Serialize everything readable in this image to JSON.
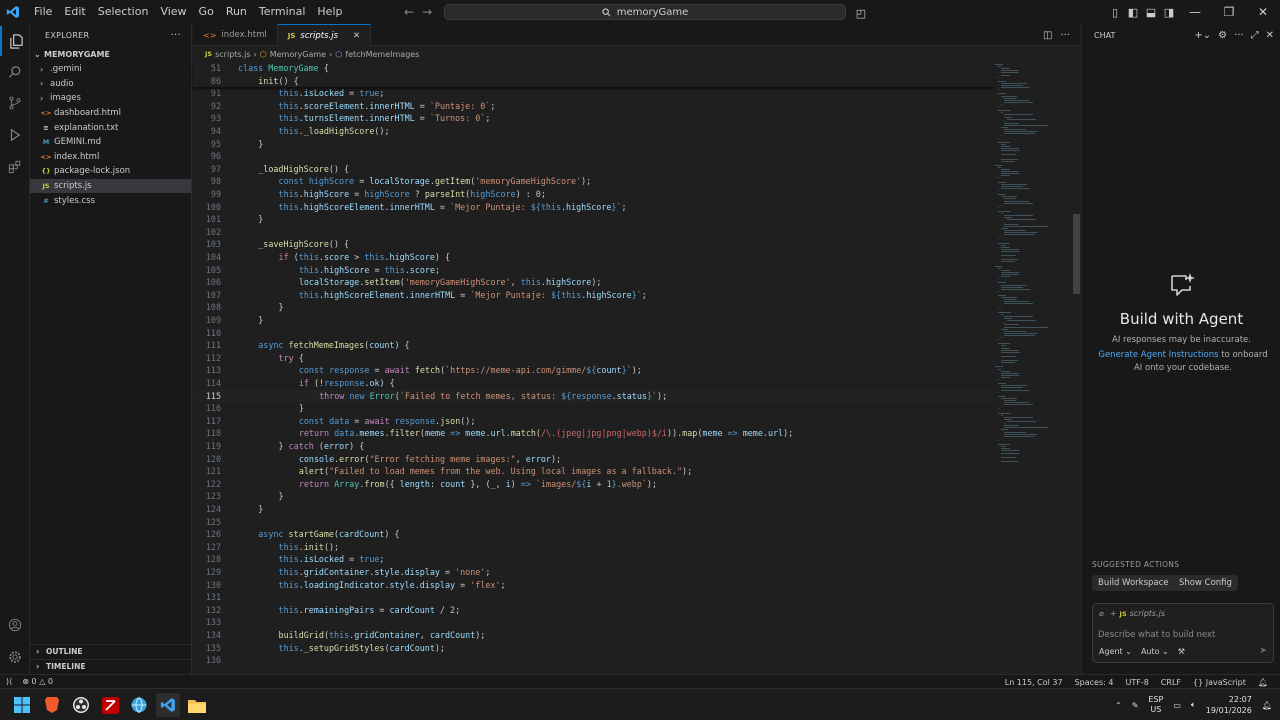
{
  "app": {
    "menu": [
      "File",
      "Edit",
      "Selection",
      "View",
      "Go",
      "Run",
      "Terminal",
      "Help"
    ],
    "search_text": "memoryGame"
  },
  "explorer": {
    "header": "EXPLORER",
    "root": "MEMORYGAME",
    "items": [
      {
        "label": ".gemini",
        "type": "folder"
      },
      {
        "label": "audio",
        "type": "folder"
      },
      {
        "label": "images",
        "type": "folder"
      },
      {
        "label": "dashboard.html",
        "type": "html"
      },
      {
        "label": "explanation.txt",
        "type": "txt"
      },
      {
        "label": "GEMINI.md",
        "type": "md"
      },
      {
        "label": "index.html",
        "type": "html"
      },
      {
        "label": "package-lock.json",
        "type": "json"
      },
      {
        "label": "scripts.js",
        "type": "js",
        "selected": true
      },
      {
        "label": "styles.css",
        "type": "css"
      }
    ],
    "outline": "OUTLINE",
    "timeline": "TIMELINE"
  },
  "tabs": [
    {
      "label": "index.html",
      "active": false
    },
    {
      "label": "scripts.js",
      "active": true
    }
  ],
  "breadcrumb": [
    "scripts.js",
    "MemoryGame",
    "fetchMemeImages"
  ],
  "code": {
    "current_line": 115,
    "lines": [
      {
        "n": "51",
        "indent": 0,
        "html": "<span class=\"kw\">class</span> <span class=\"cls\">MemoryGame</span> {"
      },
      {
        "n": "86",
        "indent": 1,
        "html": "<span class=\"fn\">init</span>() {"
      },
      {
        "n": "91",
        "indent": 2,
        "html": "<span class=\"kw\">this</span>.<span class=\"pr\">isLocked</span> = <span class=\"kw\">true</span>;"
      },
      {
        "n": "92",
        "indent": 2,
        "html": "<span class=\"kw\">this</span>.<span class=\"pr\">scoreElement</span>.<span class=\"pr\">innerHTML</span> = <span class=\"str\">`Puntaje: 0`</span>;"
      },
      {
        "n": "93",
        "indent": 2,
        "html": "<span class=\"kw\">this</span>.<span class=\"pr\">turnsElement</span>.<span class=\"pr\">innerHTML</span> = <span class=\"str\">`Turnos: 0`</span>;"
      },
      {
        "n": "94",
        "indent": 2,
        "html": "<span class=\"kw\">this</span>.<span class=\"fn\">_loadHighScore</span>();"
      },
      {
        "n": "95",
        "indent": 1,
        "html": "}"
      },
      {
        "n": "96",
        "indent": 0,
        "html": ""
      },
      {
        "n": "97",
        "indent": 1,
        "html": "<span class=\"fn\">_loadHighScore</span>() {"
      },
      {
        "n": "98",
        "indent": 2,
        "html": "<span class=\"kw\">const</span> <span class=\"tv\">highScore</span> = <span class=\"pr\">localStorage</span>.<span class=\"fn\">getItem</span>(<span class=\"str\">'memoryGameHighScore'</span>);"
      },
      {
        "n": "99",
        "indent": 2,
        "html": "<span class=\"kw\">this</span>.<span class=\"pr\">highScore</span> = <span class=\"tv\">highScore</span> ? <span class=\"fn\">parseInt</span>(<span class=\"tv\">highScore</span>) : <span class=\"num\">0</span>;"
      },
      {
        "n": "100",
        "indent": 2,
        "html": "<span class=\"kw\">this</span>.<span class=\"pr\">highScoreElement</span>.<span class=\"pr\">innerHTML</span> = <span class=\"str\">`Mejor Puntaje: </span><span class=\"kw\">${</span><span class=\"kw\">this</span>.<span class=\"pr\">highScore</span><span class=\"kw\">}</span><span class=\"str\">`</span>;"
      },
      {
        "n": "101",
        "indent": 1,
        "html": "}"
      },
      {
        "n": "102",
        "indent": 0,
        "html": ""
      },
      {
        "n": "103",
        "indent": 1,
        "html": "<span class=\"fn\">_saveHighScore</span>() {"
      },
      {
        "n": "104",
        "indent": 2,
        "html": "<span class=\"ctl\">if</span> (<span class=\"kw\">this</span>.<span class=\"pr\">score</span> &gt; <span class=\"kw\">this</span>.<span class=\"pr\">highScore</span>) {"
      },
      {
        "n": "105",
        "indent": 3,
        "html": "<span class=\"kw\">this</span>.<span class=\"pr\">highScore</span> = <span class=\"kw\">this</span>.<span class=\"pr\">score</span>;"
      },
      {
        "n": "106",
        "indent": 3,
        "html": "<span class=\"pr\">localStorage</span>.<span class=\"fn\">setItem</span>(<span class=\"str\">'memoryGameHighScore'</span>, <span class=\"kw\">this</span>.<span class=\"pr\">highScore</span>);"
      },
      {
        "n": "107",
        "indent": 3,
        "html": "<span class=\"kw\">this</span>.<span class=\"pr\">highScoreElement</span>.<span class=\"pr\">innerHTML</span> = <span class=\"str\">`Mejor Puntaje: </span><span class=\"kw\">${</span><span class=\"kw\">this</span>.<span class=\"pr\">highScore</span><span class=\"kw\">}</span><span class=\"str\">`</span>;"
      },
      {
        "n": "108",
        "indent": 2,
        "html": "}"
      },
      {
        "n": "109",
        "indent": 1,
        "html": "}"
      },
      {
        "n": "110",
        "indent": 0,
        "html": ""
      },
      {
        "n": "111",
        "indent": 1,
        "html": "<span class=\"kw\">async</span> <span class=\"fn\">fetchMemeImages</span>(<span class=\"pr\">count</span>) {"
      },
      {
        "n": "112",
        "indent": 2,
        "html": "<span class=\"ctl\">try</span> {"
      },
      {
        "n": "113",
        "indent": 3,
        "html": "<span class=\"kw\">const</span> <span class=\"tv\">response</span> = <span class=\"ctl\">await</span> <span class=\"fn\">fetch</span>(<span class=\"str\">`https://meme-api.com/gimme/</span><span class=\"kw\">${</span><span class=\"pr\">count</span><span class=\"kw\">}</span><span class=\"str\">`</span>);"
      },
      {
        "n": "114",
        "indent": 3,
        "html": "<span class=\"ctl\">if</span> (!<span class=\"tv\">response</span>.<span class=\"pr\">ok</span>) {"
      },
      {
        "n": "115",
        "indent": 4,
        "html": "<span class=\"ctl\">throw</span> <span class=\"kw\">new</span> <span class=\"cls\">Error</span>(<span class=\"str\">`Failed to fetch memes, status: </span><span class=\"kw\">${</span><span class=\"tv\">response</span>.<span class=\"pr\">status</span><span class=\"kw\">}</span><span class=\"str\">`</span>);"
      },
      {
        "n": "116",
        "indent": 3,
        "html": "}"
      },
      {
        "n": "117",
        "indent": 3,
        "html": "<span class=\"kw\">const</span> <span class=\"tv\">data</span> = <span class=\"ctl\">await</span> <span class=\"tv\">response</span>.<span class=\"fn\">json</span>();"
      },
      {
        "n": "118",
        "indent": 3,
        "html": "<span class=\"ctl\">return</span> <span class=\"tv\">data</span>.<span class=\"pr\">memes</span>.<span class=\"fn\">filter</span>(<span class=\"pr\">meme</span> <span class=\"kw\">=&gt;</span> <span class=\"pr\">meme</span>.<span class=\"pr\">url</span>.<span class=\"fn\">match</span>(<span class=\"rx\">/\\.(jpeg|jpg|png|webp)$/i</span>)).<span class=\"fn\">map</span>(<span class=\"pr\">meme</span> <span class=\"kw\">=&gt;</span> <span class=\"pr\">meme</span>.<span class=\"pr\">url</span>);"
      },
      {
        "n": "119",
        "indent": 2,
        "html": "} <span class=\"ctl\">catch</span> (<span class=\"pr\">error</span>) {"
      },
      {
        "n": "120",
        "indent": 3,
        "html": "<span class=\"pr\">console</span>.<span class=\"fn\">error</span>(<span class=\"str\">\"Error fetching meme images:\"</span>, <span class=\"pr\">error</span>);"
      },
      {
        "n": "121",
        "indent": 3,
        "html": "<span class=\"fn\">alert</span>(<span class=\"str\">\"Failed to load memes from the web. Using local images as a fallback.\"</span>);"
      },
      {
        "n": "122",
        "indent": 3,
        "html": "<span class=\"ctl\">return</span> <span class=\"cls\">Array</span>.<span class=\"fn\">from</span>({ <span class=\"pr\">length</span>: <span class=\"pr\">count</span> }, (<span class=\"pr\">_</span>, <span class=\"pr\">i</span>) <span class=\"kw\">=&gt;</span> <span class=\"str\">`images/</span><span class=\"kw\">${</span><span class=\"pr\">i</span> + <span class=\"num\">1</span><span class=\"kw\">}</span><span class=\"str\">.webp`</span>);"
      },
      {
        "n": "123",
        "indent": 2,
        "html": "}"
      },
      {
        "n": "124",
        "indent": 1,
        "html": "}"
      },
      {
        "n": "125",
        "indent": 0,
        "html": ""
      },
      {
        "n": "126",
        "indent": 1,
        "html": "<span class=\"kw\">async</span> <span class=\"fn\">startGame</span>(<span class=\"pr\">cardCount</span>) {"
      },
      {
        "n": "127",
        "indent": 2,
        "html": "<span class=\"kw\">this</span>.<span class=\"fn\">init</span>();"
      },
      {
        "n": "128",
        "indent": 2,
        "html": "<span class=\"kw\">this</span>.<span class=\"pr\">isLocked</span> = <span class=\"kw\">true</span>;"
      },
      {
        "n": "129",
        "indent": 2,
        "html": "<span class=\"kw\">this</span>.<span class=\"pr\">gridContainer</span>.<span class=\"pr\">style</span>.<span class=\"pr\">display</span> = <span class=\"str\">'none'</span>;"
      },
      {
        "n": "130",
        "indent": 2,
        "html": "<span class=\"kw\">this</span>.<span class=\"pr\">loadingIndicator</span>.<span class=\"pr\">style</span>.<span class=\"pr\">display</span> = <span class=\"str\">'flex'</span>;"
      },
      {
        "n": "131",
        "indent": 0,
        "html": ""
      },
      {
        "n": "132",
        "indent": 2,
        "html": "<span class=\"kw\">this</span>.<span class=\"pr\">remainingPairs</span> = <span class=\"pr\">cardCount</span> / <span class=\"num\">2</span>;"
      },
      {
        "n": "133",
        "indent": 0,
        "html": ""
      },
      {
        "n": "134",
        "indent": 2,
        "html": "<span class=\"fn\">buildGrid</span>(<span class=\"kw\">this</span>.<span class=\"pr\">gridContainer</span>, <span class=\"pr\">cardCount</span>);"
      },
      {
        "n": "135",
        "indent": 2,
        "html": "<span class=\"kw\">this</span>.<span class=\"fn\">_setupGridStyles</span>(<span class=\"pr\">cardCount</span>);"
      },
      {
        "n": "136",
        "indent": 0,
        "html": ""
      }
    ]
  },
  "chat": {
    "header": "CHAT",
    "title": "Build with Agent",
    "note": "AI responses may be inaccurate.",
    "link": "Generate Agent Instructions",
    "instr_rest": " to onboard AI onto your codebase.",
    "suggested_label": "SUGGESTED ACTIONS",
    "suggestions": [
      "Build Workspace",
      "Show Config"
    ],
    "attached_file": "scripts.js",
    "placeholder": "Describe what to build next",
    "mode": "Agent",
    "model": "Auto"
  },
  "status": {
    "problems": "0",
    "warnings": "0",
    "position": "Ln 115, Col 37",
    "spaces": "Spaces: 4",
    "encoding": "UTF-8",
    "eol": "CRLF",
    "language": "JavaScript"
  },
  "taskbar": {
    "lang_top": "ESP",
    "lang_bottom": "US",
    "time": "22:07",
    "date": "19/01/2026"
  }
}
